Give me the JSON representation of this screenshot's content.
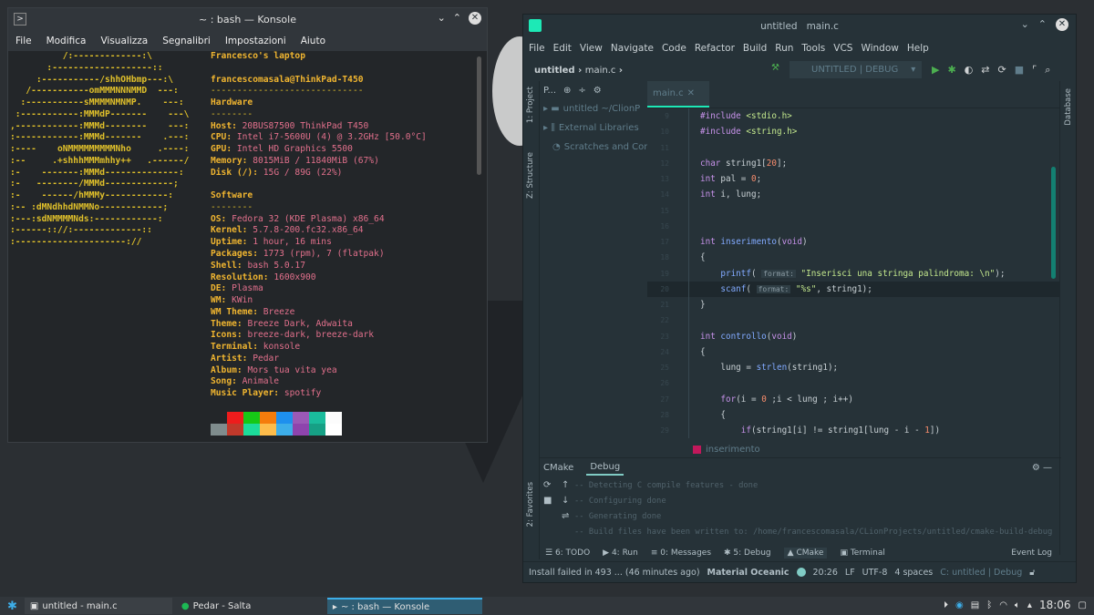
{
  "konsole": {
    "title": "~ : bash — Konsole",
    "menu": [
      "File",
      "Modifica",
      "Visualizza",
      "Segnalibri",
      "Impostazioni",
      "Aiuto"
    ],
    "ascii": [
      "          /:-------------:\\",
      "       :-------------------::",
      "     :-----------/shhOHbmp---:\\",
      "   /-----------omMMMNNNMMD  ---:",
      "  :-----------sMMMMNMNMP.    ---:",
      " :-----------:MMMdP-------    ---\\",
      ",------------:MMMd--------    ---:",
      ":------------:MMMd-------    .---:",
      ":----    oNMMMMMMMMMNho     .----:",
      ":--     .+shhhMMMmhhy++   .------/",
      ":-    -------:MMMd--------------:",
      ":-   --------/MMMd-------------;",
      ":-    ------/hMMMy------------:",
      ":-- :dMNdhhdNMMNo------------;",
      ":---:sdNMMMMNds:------------:",
      ":------:://:-------------::",
      ":---------------------://"
    ],
    "info": [
      {
        "label": "Francesco's laptop",
        "value": ""
      },
      {
        "label": "",
        "value": ""
      },
      {
        "label": "francescomasala@ThinkPad-T450",
        "value": ""
      },
      {
        "label": "",
        "value": "-----------------------------"
      },
      {
        "label": "Hardware",
        "value": ""
      },
      {
        "label": "",
        "value": "--------"
      },
      {
        "label": "Host: ",
        "value": "20BUS87500 ThinkPad T450"
      },
      {
        "label": "CPU: ",
        "value": "Intel i7-5600U (4) @ 3.2GHz [50.0°C]"
      },
      {
        "label": "GPU: ",
        "value": "Intel HD Graphics 5500"
      },
      {
        "label": "Memory: ",
        "value": "8015MiB / 11840MiB (67%)"
      },
      {
        "label": "Disk (/): ",
        "value": "15G / 89G (22%)"
      },
      {
        "label": "",
        "value": ""
      },
      {
        "label": "Software",
        "value": ""
      },
      {
        "label": "",
        "value": "--------"
      },
      {
        "label": "OS: ",
        "value": "Fedora 32 (KDE Plasma) x86_64"
      },
      {
        "label": "Kernel: ",
        "value": "5.7.8-200.fc32.x86_64"
      },
      {
        "label": "Uptime: ",
        "value": "1 hour, 16 mins"
      },
      {
        "label": "Packages: ",
        "value": "1773 (rpm), 7 (flatpak)"
      },
      {
        "label": "Shell: ",
        "value": "bash 5.0.17"
      },
      {
        "label": "Resolution: ",
        "value": "1600x900"
      },
      {
        "label": "DE: ",
        "value": "Plasma"
      },
      {
        "label": "WM: ",
        "value": "KWin"
      },
      {
        "label": "WM Theme: ",
        "value": "Breeze"
      },
      {
        "label": "Theme: ",
        "value": "Breeze Dark, Adwaita"
      },
      {
        "label": "Icons: ",
        "value": "breeze-dark, breeze-dark"
      },
      {
        "label": "Terminal: ",
        "value": "konsole"
      },
      {
        "label": "Artist: ",
        "value": "Pedar"
      },
      {
        "label": "Album: ",
        "value": "Mors tua vita yea"
      },
      {
        "label": "Song: ",
        "value": "Animale"
      },
      {
        "label": "Music Player: ",
        "value": "spotify"
      }
    ],
    "palette_top": [
      "#232629",
      "#ee1c1c",
      "#16c816",
      "#f57c0c",
      "#1e90ee",
      "#9b59b6",
      "#1abc9c",
      "#fcfcfc"
    ],
    "palette_bottom": [
      "#7f8c8d",
      "#c0392b",
      "#1cdc9a",
      "#fdbc4b",
      "#3daee9",
      "#8e44ad",
      "#16a085",
      "#ffffff"
    ]
  },
  "clion": {
    "title": "untitled",
    "title_file": "main.c",
    "menu": [
      "File",
      "Edit",
      "View",
      "Navigate",
      "Code",
      "Refactor",
      "Build",
      "Run",
      "Tools",
      "VCS",
      "Window",
      "Help"
    ],
    "breadcrumb_project": "untitled",
    "breadcrumb_file": "main.c",
    "run_config": "UNTITLED | DEBUG",
    "left_strip": {
      "project": "1: Project",
      "structure": "Z: Structure",
      "favorites": "2: Favorites"
    },
    "right_strip": "Database",
    "project_header": "P...",
    "project_items": [
      "untitled  ~/ClionP",
      "External Libraries",
      "Scratches and Con"
    ],
    "editor_tab": "main.c",
    "code_lines": [
      {
        "n": "9",
        "html": "<span class='kw'>#include</span> <span class='str'>&lt;stdio.h&gt;</span>"
      },
      {
        "n": "10",
        "html": "<span class='kw'>#include</span> <span class='str'>&lt;string.h&gt;</span>"
      },
      {
        "n": "11",
        "html": ""
      },
      {
        "n": "12",
        "html": "<span class='kw'>char</span> string1[<span class='num'>20</span>];"
      },
      {
        "n": "13",
        "html": "<span class='kw'>int</span> pal = <span class='num'>0</span>;"
      },
      {
        "n": "14",
        "html": "<span class='kw'>int</span> i, lung;"
      },
      {
        "n": "15",
        "html": ""
      },
      {
        "n": "16",
        "html": ""
      },
      {
        "n": "17",
        "html": "<span class='kw'>int</span> <span class='fn'>inserimento</span>(<span class='kw'>void</span>)"
      },
      {
        "n": "18",
        "html": "{"
      },
      {
        "n": "19",
        "html": "    <span class='fn'>printf</span>( <span class='hint'>format:</span> <span class='str'>\"Inserisci una stringa palindroma: \\n\"</span>);"
      },
      {
        "n": "20",
        "html": "    <span class='fn'>scanf</span>( <span class='hint'>format:</span> <span class='str'>\"%s\"</span>, string1);",
        "cur": true
      },
      {
        "n": "21",
        "html": "}"
      },
      {
        "n": "22",
        "html": ""
      },
      {
        "n": "23",
        "html": "<span class='kw'>int</span> <span class='fn'>controllo</span>(<span class='kw'>void</span>)"
      },
      {
        "n": "24",
        "html": "{"
      },
      {
        "n": "25",
        "html": "    lung = <span class='fn'>strlen</span>(string1);"
      },
      {
        "n": "26",
        "html": ""
      },
      {
        "n": "27",
        "html": "    <span class='kw'>for</span>(i = <span class='num'>0</span> ;i &lt; lung ; i++)"
      },
      {
        "n": "28",
        "html": "    {"
      },
      {
        "n": "29",
        "html": "        <span class='kw'>if</span>(string1[i] != string1[lung - i - <span class='num'>1</span>])"
      }
    ],
    "editor_crumb": "inserimento",
    "bottom_tabs": [
      "CMake",
      "Debug"
    ],
    "console_lines": [
      "-- Detecting C compile features - done",
      "-- Configuring done",
      "-- Generating done",
      "-- Build files have been written to: /home/francescomasala/CLionProjects/untitled/cmake-build-debug"
    ],
    "tool_windows": [
      "6: TODO",
      "4: Run",
      "0: Messages",
      "5: Debug",
      "CMake",
      "Terminal"
    ],
    "event_log": "Event Log",
    "status": {
      "message": "Install failed in 493 ... (46 minutes ago)",
      "theme": "Material Oceanic",
      "position": "20:26",
      "line_sep": "LF",
      "encoding": "UTF-8",
      "indent": "4 spaces",
      "context": "C: untitled | Debug"
    },
    "accent": "#1de9b6"
  },
  "taskbar": {
    "tasks": [
      "untitled - main.c",
      "Pedar - Salta",
      "~ : bash — Konsole"
    ],
    "clock": "18:06"
  }
}
